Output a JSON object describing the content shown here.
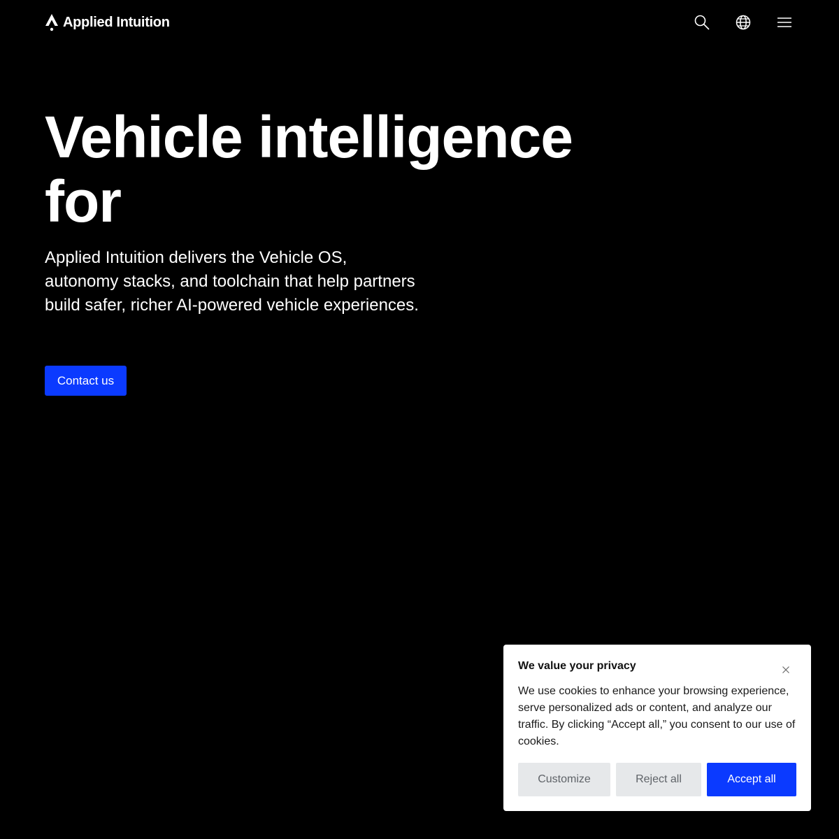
{
  "header": {
    "brand_name": "Applied Intuition",
    "icons": [
      "search-icon",
      "globe-icon",
      "menu-icon"
    ]
  },
  "hero": {
    "title": "Vehicle intelligence for",
    "description": "Applied Intuition delivers the Vehicle OS, autonomy stacks, and toolchain that help partners build safer, richer AI-powered vehicle experiences.",
    "cta_label": "Contact us"
  },
  "cookie_banner": {
    "title": "We value your privacy",
    "text": "We use cookies to enhance your browsing experience, serve personalized ads or content, and analyze our traffic. By clicking “Accept all,” you consent to our use of cookies.",
    "customize_label": "Customize",
    "reject_label": "Reject all",
    "accept_label": "Accept all",
    "close_icon": "close-icon"
  },
  "colors": {
    "background": "#000000",
    "accent": "#0b3aff",
    "text": "#ffffff",
    "secondary_button": "#e6e8ea"
  }
}
